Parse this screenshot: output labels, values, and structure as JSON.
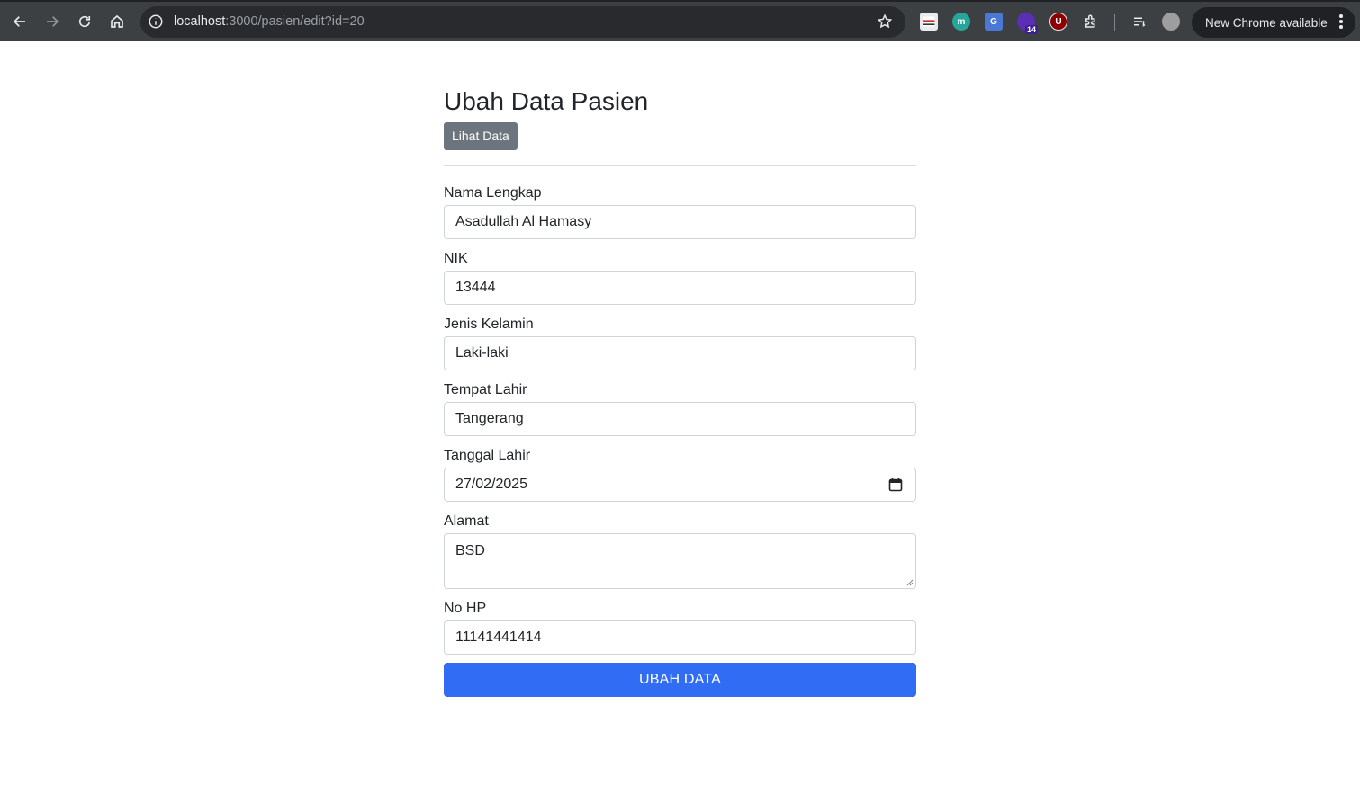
{
  "browser": {
    "url_host": "localhost",
    "url_path": ":3000/pasien/edit?id=20",
    "new_chrome_label": "New Chrome available",
    "ext_badge": "14",
    "icons": [
      "back-icon",
      "forward-icon",
      "reload-icon",
      "home-icon",
      "site-info-icon",
      "bookmark-star-icon",
      "extensions-puzzle-icon",
      "reading-list-icon",
      "profile-avatar",
      "more-menu-icon"
    ]
  },
  "page": {
    "title": "Ubah Data Pasien",
    "view_button": "Lihat Data",
    "submit_button": "UBAH DATA"
  },
  "form": {
    "nama": {
      "label": "Nama Lengkap",
      "value": "Asadullah Al Hamasy"
    },
    "nik": {
      "label": "NIK",
      "value": "13444"
    },
    "jk": {
      "label": "Jenis Kelamin",
      "value": "Laki-laki"
    },
    "tempat": {
      "label": "Tempat Lahir",
      "value": "Tangerang"
    },
    "tanggal": {
      "label": "Tanggal Lahir",
      "value": "27/02/2025"
    },
    "alamat": {
      "label": "Alamat",
      "value": "BSD"
    },
    "hp": {
      "label": "No HP",
      "value": "11141441414"
    }
  },
  "colors": {
    "primary": "#316cf4",
    "secondary": "#6c757d",
    "toolbar": "#3c4043"
  }
}
